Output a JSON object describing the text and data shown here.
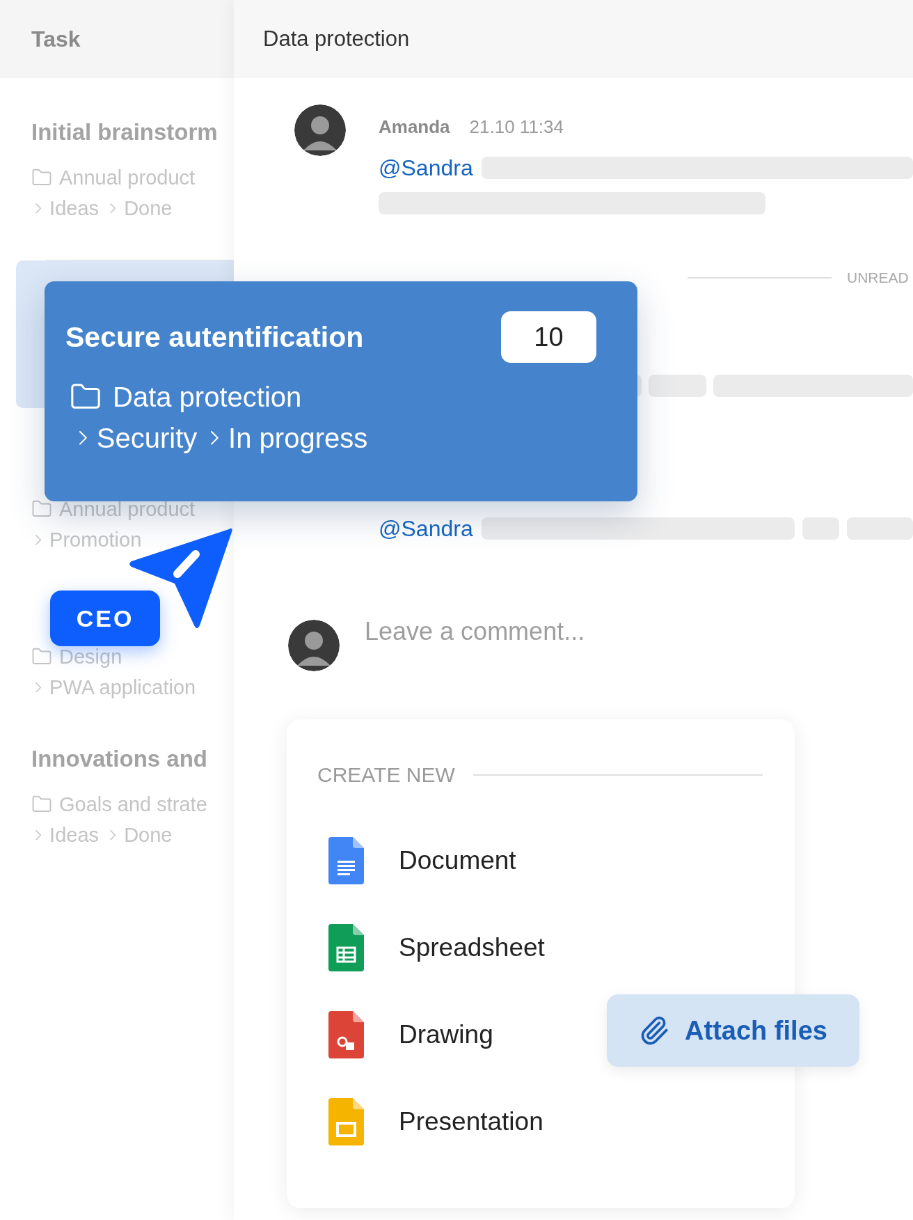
{
  "sidebar": {
    "title": "Task",
    "tasks": [
      {
        "title": "Initial brainstorm",
        "folder": "Annual product",
        "path": [
          "Ideas",
          "Done"
        ],
        "selected": false
      },
      {
        "selected": true
      },
      {
        "folder": "Annual product",
        "path": [
          "Promotion"
        ],
        "selected": false
      },
      {
        "folder": "Design",
        "path": [
          "PWA application"
        ],
        "selected": false
      },
      {
        "title": "Innovations and",
        "folder": "Goals and strate",
        "path": [
          "Ideas",
          "Done"
        ],
        "selected": false
      }
    ]
  },
  "panel": {
    "title": "Data protection",
    "messages": [
      {
        "kind": "full",
        "author": "Amanda",
        "time": "21.10 11:34",
        "mention": "@Sandra"
      },
      {
        "kind": "divider",
        "label": "UNREAD"
      },
      {
        "kind": "partial",
        "mention": "@Sandra"
      }
    ],
    "comment": {
      "placeholder": "Leave a comment..."
    },
    "create_menu": {
      "heading": "CREATE NEW",
      "items": [
        {
          "kind": "document",
          "label": "Document"
        },
        {
          "kind": "spreadsheet",
          "label": "Spreadsheet"
        },
        {
          "kind": "drawing",
          "label": "Drawing"
        },
        {
          "kind": "presentation",
          "label": "Presentation"
        }
      ]
    },
    "attach_button": {
      "label": "Attach files"
    }
  },
  "task_card": {
    "title": "Secure autentification",
    "count": "10",
    "folder": "Data protection",
    "path": [
      "Security",
      "In progress"
    ]
  },
  "cursor_tag": {
    "label": "CEO"
  }
}
